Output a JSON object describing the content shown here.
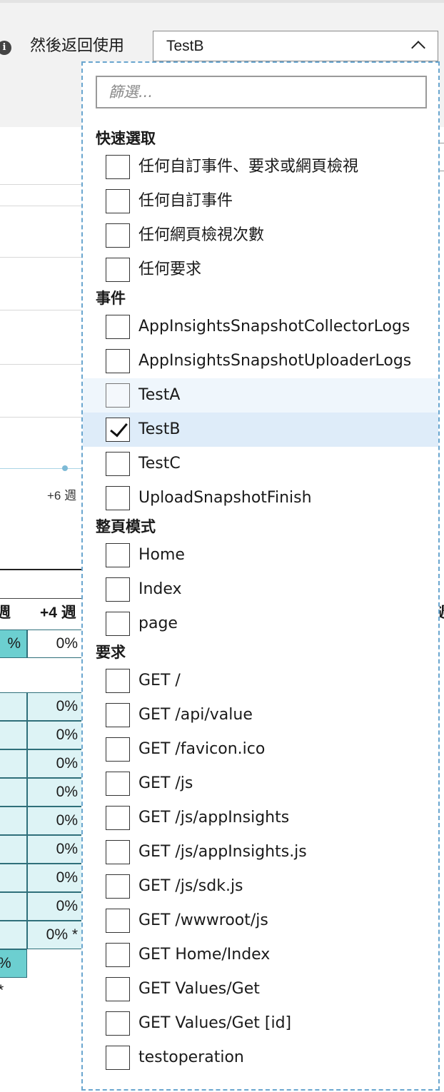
{
  "header": {
    "then_label": "然後返回使用",
    "selected_value": "TestB"
  },
  "background": {
    "axis_label": "+6 週",
    "col_headers": [
      "週",
      "+4 週",
      "週"
    ],
    "row_first": [
      "%",
      "0%"
    ],
    "col_values": [
      "0%",
      "0%",
      "0%",
      "0%",
      "0%",
      "0%",
      "0%",
      "0%",
      "0% *"
    ],
    "last_cell": "% *"
  },
  "dropdown": {
    "filter_placeholder": "篩選...",
    "groups": [
      {
        "title": "快速選取",
        "items": [
          {
            "label": "任何自訂事件、要求或網頁檢視",
            "checked": false
          },
          {
            "label": "任何自訂事件",
            "checked": false
          },
          {
            "label": "任何網頁檢視次數",
            "checked": false
          },
          {
            "label": "任何要求",
            "checked": false
          }
        ]
      },
      {
        "title": "事件",
        "items": [
          {
            "label": "AppInsightsSnapshotCollectorLogs",
            "checked": false
          },
          {
            "label": "AppInsightsSnapshotUploaderLogs",
            "checked": false
          },
          {
            "label": "TestA",
            "checked": false,
            "state": "hover"
          },
          {
            "label": "TestB",
            "checked": true,
            "state": "selected"
          },
          {
            "label": "TestC",
            "checked": false
          },
          {
            "label": "UploadSnapshotFinish",
            "checked": false
          }
        ]
      },
      {
        "title": "整頁模式",
        "items": [
          {
            "label": "Home",
            "checked": false
          },
          {
            "label": "Index",
            "checked": false
          },
          {
            "label": "page",
            "checked": false
          }
        ]
      },
      {
        "title": "要求",
        "items": [
          {
            "label": "GET /",
            "checked": false
          },
          {
            "label": "GET /api/value",
            "checked": false
          },
          {
            "label": "GET /favicon.ico",
            "checked": false
          },
          {
            "label": "GET /js",
            "checked": false
          },
          {
            "label": "GET /js/appInsights",
            "checked": false
          },
          {
            "label": "GET /js/appInsights.js",
            "checked": false
          },
          {
            "label": "GET /js/sdk.js",
            "checked": false
          },
          {
            "label": "GET /wwwroot/js",
            "checked": false
          },
          {
            "label": "GET Home/Index",
            "checked": false
          },
          {
            "label": "GET Values/Get",
            "checked": false
          },
          {
            "label": "GET Values/Get [id]",
            "checked": false
          },
          {
            "label": "testoperation",
            "checked": false
          }
        ]
      }
    ]
  },
  "colors": {
    "accent_border": "#6aa6cf",
    "selected_bg": "#deecf9",
    "hover_bg": "#eff6fc",
    "cell_dark": "#6ccfd0",
    "cell_light": "#ddf3f5"
  }
}
